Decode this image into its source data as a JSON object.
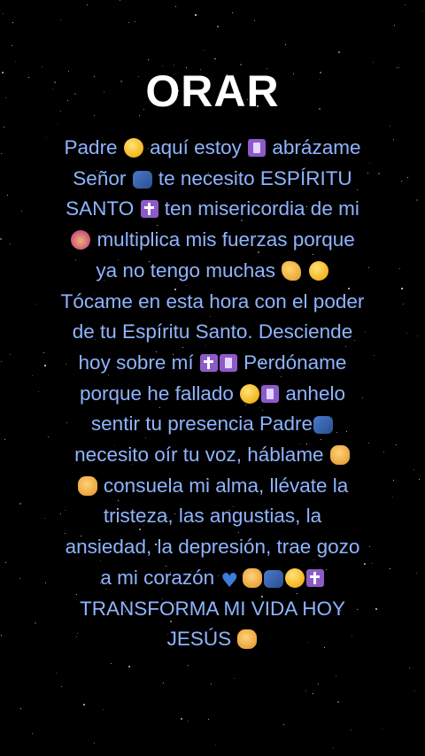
{
  "title": "ORAR",
  "prayer_lines": [
    "Padre 🥺 aquí estoy 🛐 abrázame",
    "Señor 🫂 te necesito ESPÍRITU",
    "SANTO ✝️ ten misericordia de mi",
    "🙇‍♀️ multiplica mis fuerzas porque",
    "ya no tengo muchas 💪 🥺",
    "Tócame en esta hora con el poder",
    "de tu Espíritu Santo. Desciende",
    "hoy sobre mí ✝️🛐 Perdóname",
    "porque he fallado 😔🛐 anhelo",
    "sentir tu presencia Padre🫂",
    "necesito oír tu voz, háblame 🙏",
    "🤲 consuela mi alma, llévate la",
    "tristeza, las angustias, la",
    "ansiedad, la depresión, trae gozo",
    "a mi corazón 💙 🙏🫂😔✝️",
    "TRANSFORMA MI VIDA HOY",
    "JESÚS 🙏"
  ],
  "colors": {
    "background": "#000000",
    "title": "#ffffff",
    "prayer_text": "#8fb4ff"
  }
}
